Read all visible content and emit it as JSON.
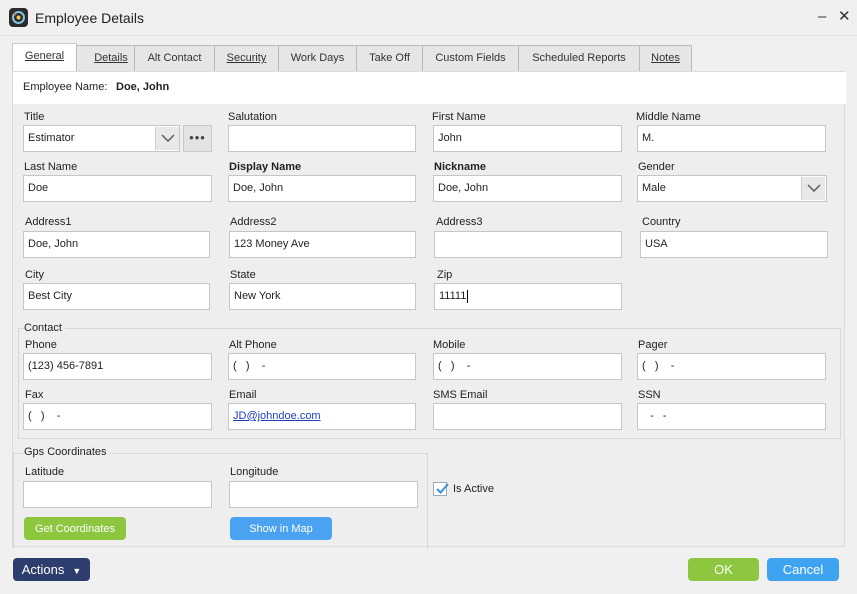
{
  "window": {
    "title": "Employee Details",
    "minimize": "–",
    "close": "✕"
  },
  "tabs": [
    {
      "label": "General",
      "active": true
    },
    {
      "label": "Details"
    },
    {
      "label": "Alt Contact"
    },
    {
      "label": "Security"
    },
    {
      "label": "Work Days"
    },
    {
      "label": "Take Off"
    },
    {
      "label": "Custom Fields"
    },
    {
      "label": "Scheduled Reports"
    },
    {
      "label": "Notes"
    }
  ],
  "employee": {
    "name_label": "Employee Name:",
    "name_value": "Doe, John"
  },
  "fields": {
    "title": {
      "label": "Title",
      "value": "Estimator"
    },
    "salutation": {
      "label": "Salutation",
      "value": ""
    },
    "first_name": {
      "label": "First Name",
      "value": "John"
    },
    "middle_name": {
      "label": "Middle Name",
      "value": "M."
    },
    "last_name": {
      "label": "Last Name",
      "value": "Doe"
    },
    "display_name": {
      "label": "Display Name",
      "value": "Doe, John"
    },
    "nickname": {
      "label": "Nickname",
      "value": "Doe, John"
    },
    "gender": {
      "label": "Gender",
      "value": "Male"
    },
    "address1": {
      "label": "Address1",
      "value": "Doe, John"
    },
    "address2": {
      "label": "Address2",
      "value": "123 Money Ave"
    },
    "address3": {
      "label": "Address3",
      "value": ""
    },
    "country": {
      "label": "Country",
      "value": "USA"
    },
    "city": {
      "label": "City",
      "value": "Best City"
    },
    "state": {
      "label": "State",
      "value": "New York"
    },
    "zip": {
      "label": "Zip",
      "value": "11111"
    }
  },
  "contact": {
    "group_label": "Contact",
    "phone": {
      "label": "Phone",
      "value": "(123) 456-7891"
    },
    "alt_phone": {
      "label": "Alt Phone",
      "value": "(   )    -"
    },
    "mobile": {
      "label": "Mobile",
      "value": "(   )    -"
    },
    "pager": {
      "label": "Pager",
      "value": "(   )    -"
    },
    "fax": {
      "label": "Fax",
      "value": "(   )    -"
    },
    "email": {
      "label": "Email",
      "value": "JD@johndoe.com"
    },
    "sms_email": {
      "label": "SMS Email",
      "value": ""
    },
    "ssn": {
      "label": "SSN",
      "value": "-   -"
    }
  },
  "gps": {
    "group_label": "Gps Coordinates",
    "latitude": {
      "label": "Latitude",
      "value": ""
    },
    "longitude": {
      "label": "Longitude",
      "value": ""
    },
    "get_coordinates": "Get Coordinates",
    "show_in_map": "Show in Map"
  },
  "is_active": {
    "label": "Is Active",
    "checked": true
  },
  "footer": {
    "actions": "Actions",
    "ok": "OK",
    "cancel": "Cancel"
  },
  "colors": {
    "accent_green": "#8dc63f",
    "accent_blue": "#3ea3f1",
    "actions_navy": "#2d3e6e"
  }
}
